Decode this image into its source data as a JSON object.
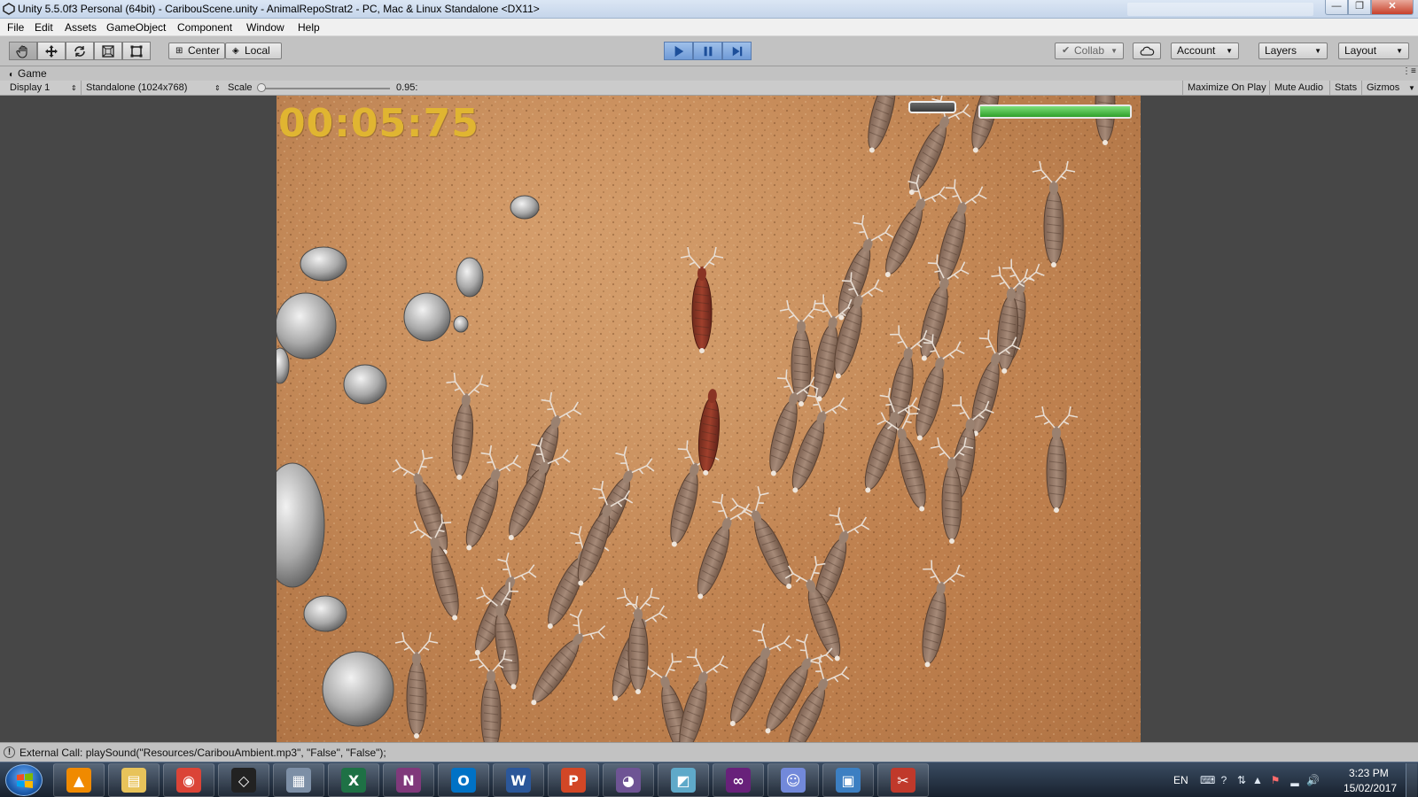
{
  "window": {
    "title": "Unity 5.5.0f3 Personal (64bit) - CaribouScene.unity - AnimalRepoStrat2 - PC, Mac & Linux Standalone <DX11>",
    "min_label": "—",
    "max_label": "❐",
    "close_label": "✕"
  },
  "menu": [
    "File",
    "Edit",
    "Assets",
    "GameObject",
    "Component",
    "Window",
    "Help"
  ],
  "toolbar": {
    "pivot_label": "Center",
    "space_label": "Local",
    "collab_label": "Collab",
    "account_label": "Account",
    "layers_label": "Layers",
    "layout_label": "Layout"
  },
  "game_view": {
    "tab_label": "Game",
    "display_label": "Display 1",
    "resolution_label": "Standalone (1024x768)",
    "scale_label": "Scale",
    "scale_value": "0.95:",
    "maximize_label": "Maximize On Play",
    "mute_label": "Mute Audio",
    "stats_label": "Stats",
    "gizmos_label": "Gizmos"
  },
  "game": {
    "timer": "00:05:75",
    "health_fraction": 1.0,
    "colors": {
      "timer": "#e0b531",
      "health": "#3fb83a",
      "ground": "#c18553"
    }
  },
  "status": {
    "message": "External Call: playSound(\"Resources/CaribouAmbient.mp3\", \"False\", \"False\");"
  },
  "taskbar": {
    "apps": [
      {
        "name": "vlc-icon",
        "glyph": "▲",
        "color": "#f08a00"
      },
      {
        "name": "file-explorer-icon",
        "glyph": "▤",
        "color": "#e8c35a"
      },
      {
        "name": "chrome-icon",
        "glyph": "◉",
        "color": "#db4437"
      },
      {
        "name": "unity-icon",
        "glyph": "◇",
        "color": "#222222"
      },
      {
        "name": "calculator-icon",
        "glyph": "▦",
        "color": "#7d8fa6"
      },
      {
        "name": "excel-icon",
        "glyph": "X",
        "color": "#1e7145"
      },
      {
        "name": "onenote-icon",
        "glyph": "N",
        "color": "#80397b"
      },
      {
        "name": "outlook-icon",
        "glyph": "O",
        "color": "#0072c6"
      },
      {
        "name": "word-icon",
        "glyph": "W",
        "color": "#2b579a"
      },
      {
        "name": "powerpoint-icon",
        "glyph": "P",
        "color": "#d24726"
      },
      {
        "name": "github-desktop-icon",
        "glyph": "◕",
        "color": "#6e5494"
      },
      {
        "name": "notes-icon",
        "glyph": "◩",
        "color": "#5fa9c9"
      },
      {
        "name": "visual-studio-icon",
        "glyph": "∞",
        "color": "#68217a"
      },
      {
        "name": "discord-icon",
        "glyph": "☺",
        "color": "#7289da"
      },
      {
        "name": "photos-icon",
        "glyph": "▣",
        "color": "#3c7fc2"
      },
      {
        "name": "snipping-tool-icon",
        "glyph": "✂",
        "color": "#c0392b"
      }
    ],
    "language": "EN",
    "time": "3:23 PM",
    "date": "15/02/2017"
  }
}
